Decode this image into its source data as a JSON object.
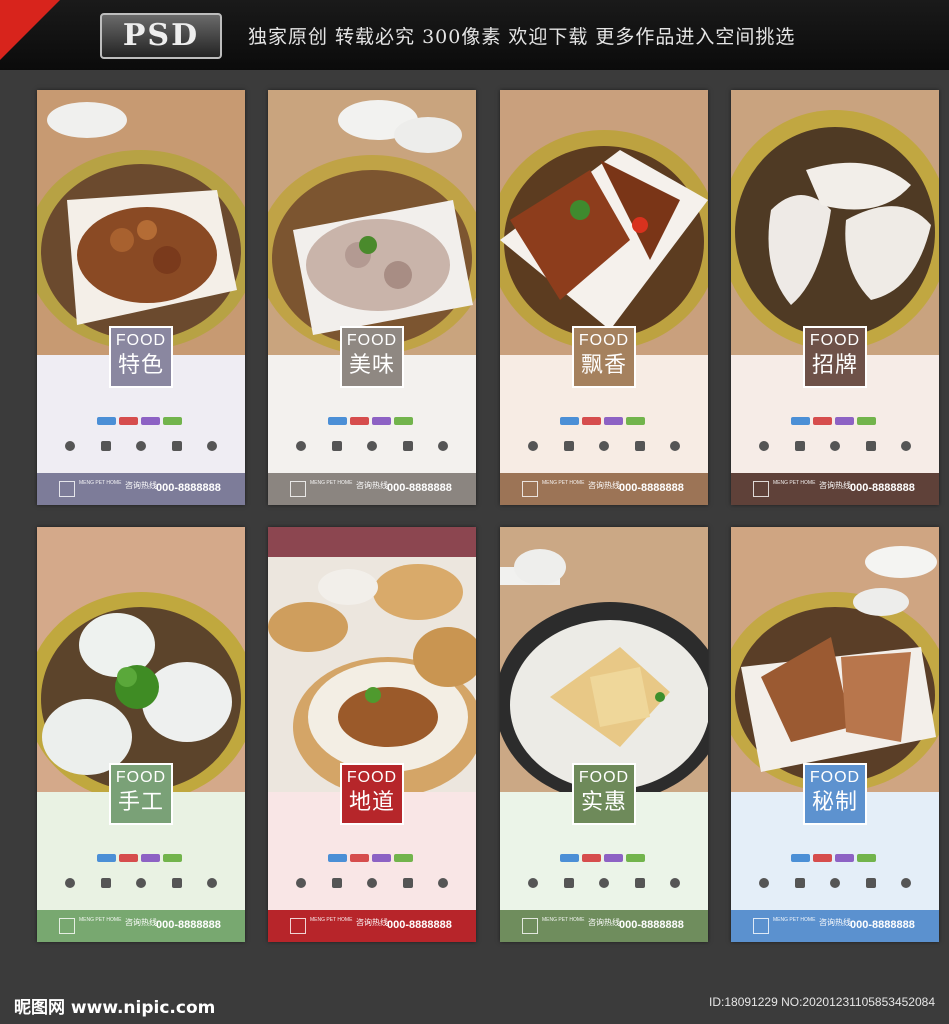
{
  "header": {
    "logo_text": "PSD",
    "slogan": "独家原创  转载必究  300像素  欢迎下载  更多作品进入空间挑选"
  },
  "cards": [
    {
      "food": "FOOD",
      "title": "特色",
      "phone_label": "咨询热线",
      "phone": "000-8888888",
      "home": "MENG PET HOME",
      "colors": {
        "panel": "#efedf3",
        "badge": "#8a87a0",
        "footer": "#7d7c99"
      }
    },
    {
      "food": "FOOD",
      "title": "美味",
      "phone_label": "咨询热线",
      "phone": "000-8888888",
      "home": "MENG PET HOME",
      "colors": {
        "panel": "#f3f1ee",
        "badge": "#8f8882",
        "footer": "#8b8580"
      }
    },
    {
      "food": "FOOD",
      "title": "飘香",
      "phone_label": "咨询热线",
      "phone": "000-8888888",
      "home": "MENG PET HOME",
      "colors": {
        "panel": "#f7ece4",
        "badge": "#a5815e",
        "footer": "#9c7456"
      }
    },
    {
      "food": "FOOD",
      "title": "招牌",
      "phone_label": "咨询热线",
      "phone": "000-8888888",
      "home": "MENG PET HOME",
      "colors": {
        "panel": "#f6ece7",
        "badge": "#6e5148",
        "footer": "#5f4139"
      }
    },
    {
      "food": "FOOD",
      "title": "手工",
      "phone_label": "咨询热线",
      "phone": "000-8888888",
      "home": "MENG PET HOME",
      "colors": {
        "panel": "#e9f2e3",
        "badge": "#7aa177",
        "footer": "#78a870"
      }
    },
    {
      "food": "FOOD",
      "title": "地道",
      "phone_label": "咨询热线",
      "phone": "000-8888888",
      "home": "MENG PET HOME",
      "colors": {
        "panel": "#f9e6e6",
        "badge": "#b6262a",
        "footer": "#b7252a"
      }
    },
    {
      "food": "FOOD",
      "title": "实惠",
      "phone_label": "咨询热线",
      "phone": "000-8888888",
      "home": "MENG PET HOME",
      "colors": {
        "panel": "#ebf4e8",
        "badge": "#6e8a5a",
        "footer": "#6f8d5d"
      }
    },
    {
      "food": "FOOD",
      "title": "秘制",
      "phone_label": "咨询热线",
      "phone": "000-8888888",
      "home": "MENG PET HOME",
      "colors": {
        "panel": "#e4eef8",
        "badge": "#5d92cf",
        "footer": "#5b91cf"
      }
    }
  ],
  "watermark": {
    "left": "昵图网 www.nipic.com",
    "right": "ID:18091229 NO:20201231105853452084"
  }
}
